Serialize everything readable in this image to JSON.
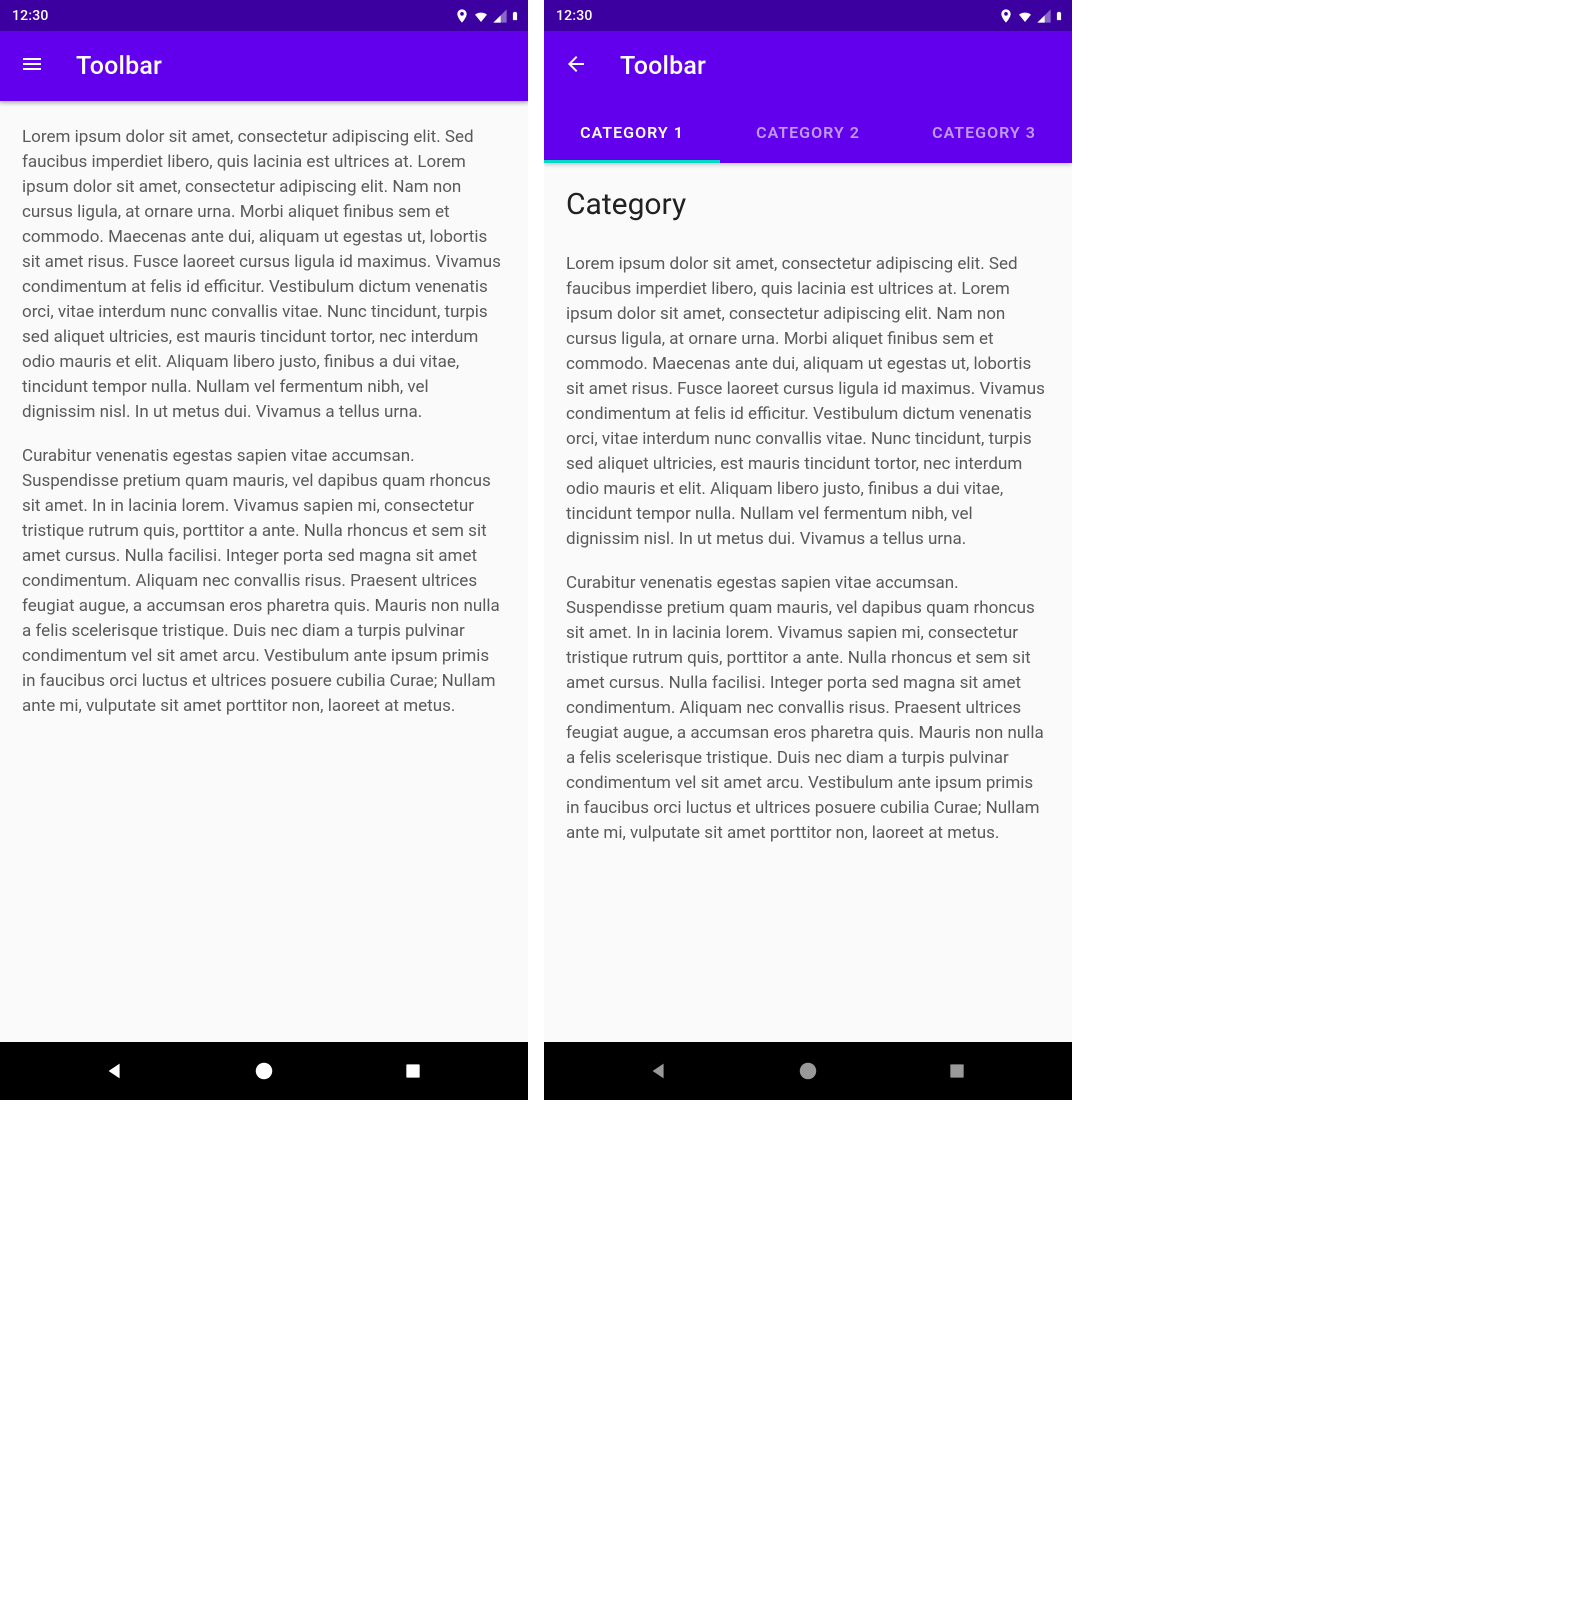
{
  "colors": {
    "status": "#3c00a0",
    "primary": "#6200ee",
    "indicator": "#03dac5"
  },
  "status": {
    "time": "12:30"
  },
  "left": {
    "toolbar": {
      "title": "Toolbar",
      "nav_icon": "menu-icon"
    },
    "body": {
      "p1": "Lorem ipsum dolor sit amet, consectetur adipiscing elit. Sed faucibus imperdiet libero, quis lacinia est ultrices at. Lorem ipsum dolor sit amet, consectetur adipiscing elit. Nam non cursus ligula, at ornare urna. Morbi aliquet finibus sem et commodo. Maecenas ante dui, aliquam ut egestas ut, lobortis sit amet risus. Fusce laoreet cursus ligula id maximus. Vivamus condimentum at felis id efficitur. Vestibulum dictum venenatis orci, vitae interdum nunc convallis vitae. Nunc tincidunt, turpis sed aliquet ultricies, est mauris tincidunt tortor, nec interdum odio mauris et elit. Aliquam libero justo, finibus a dui vitae, tincidunt tempor nulla. Nullam vel fermentum nibh, vel dignissim nisl. In ut metus dui. Vivamus a tellus urna.",
      "p2": "Curabitur venenatis egestas sapien vitae accumsan. Suspendisse pretium quam mauris, vel dapibus quam rhoncus sit amet. In in lacinia lorem. Vivamus sapien mi, consectetur tristique rutrum quis, porttitor a ante. Nulla rhoncus et sem sit amet cursus. Nulla facilisi. Integer porta sed magna sit amet condimentum. Aliquam nec convallis risus. Praesent ultrices feugiat augue, a accumsan eros pharetra quis. Mauris non nulla a felis scelerisque tristique. Duis nec diam a turpis pulvinar condimentum vel sit amet arcu. Vestibulum ante ipsum primis in faucibus orci luctus et ultrices posuere cubilia Curae; Nullam ante mi, vulputate sit amet porttitor non, laoreet at metus."
    }
  },
  "right": {
    "toolbar": {
      "title": "Toolbar",
      "nav_icon": "back-icon"
    },
    "tabs": [
      {
        "label": "CATEGORY 1",
        "active": true
      },
      {
        "label": "CATEGORY 2",
        "active": false
      },
      {
        "label": "CATEGORY 3",
        "active": false
      }
    ],
    "heading": "Category",
    "body": {
      "p1": "Lorem ipsum dolor sit amet, consectetur adipiscing elit. Sed faucibus imperdiet libero, quis lacinia est ultrices at. Lorem ipsum dolor sit amet, consectetur adipiscing elit. Nam non cursus ligula, at ornare urna. Morbi aliquet finibus sem et commodo. Maecenas ante dui, aliquam ut egestas ut, lobortis sit amet risus. Fusce laoreet cursus ligula id maximus. Vivamus condimentum at felis id efficitur. Vestibulum dictum venenatis orci, vitae interdum nunc convallis vitae. Nunc tincidunt, turpis sed aliquet ultricies, est mauris tincidunt tortor, nec interdum odio mauris et elit. Aliquam libero justo, finibus a dui vitae, tincidunt tempor nulla. Nullam vel fermentum nibh, vel dignissim nisl. In ut metus dui. Vivamus a tellus urna.",
      "p2": "Curabitur venenatis egestas sapien vitae accumsan. Suspendisse pretium quam mauris, vel dapibus quam rhoncus sit amet. In in lacinia lorem. Vivamus sapien mi, consectetur tristique rutrum quis, porttitor a ante. Nulla rhoncus et sem sit amet cursus. Nulla facilisi. Integer porta sed magna sit amet condimentum. Aliquam nec convallis risus. Praesent ultrices feugiat augue, a accumsan eros pharetra quis. Mauris non nulla a felis scelerisque tristique. Duis nec diam a turpis pulvinar condimentum vel sit amet arcu. Vestibulum ante ipsum primis in faucibus orci luctus et ultrices posuere cubilia Curae; Nullam ante mi, vulputate sit amet porttitor non, laoreet at metus."
    }
  }
}
